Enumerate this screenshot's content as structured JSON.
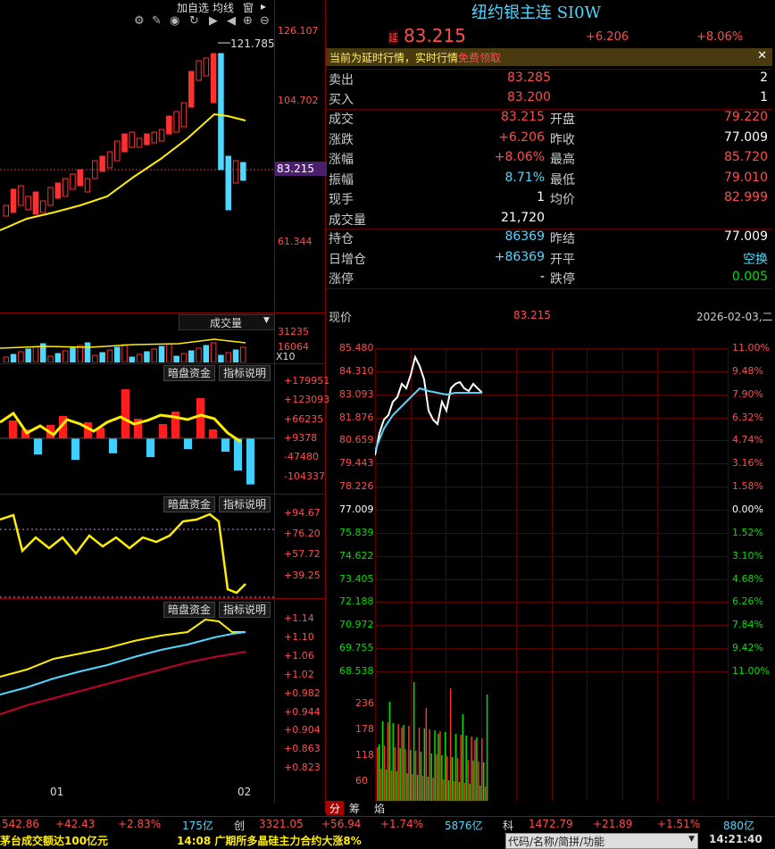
{
  "toolbar": {
    "add_watch": "加自选",
    "ma": "均线",
    "window": "窗",
    "arrow_icon": "arrow-icon"
  },
  "kline": {
    "ticks": [
      "126.107",
      "104.702",
      "83.215",
      "61.344"
    ],
    "max_label": "121.785",
    "current_label": "83.215",
    "x_labels": [
      "01",
      "02"
    ]
  },
  "volume_panel": {
    "selector": "成交量",
    "ticks": [
      "31235",
      "16064",
      "X10"
    ]
  },
  "indicator1": {
    "btn_dark": "暗盘资金",
    "btn_help": "指标说明",
    "ticks": [
      "+179951",
      "+123093",
      "+66235",
      "+9378",
      "-47480",
      "-104337"
    ]
  },
  "indicator2": {
    "btn_dark": "暗盘资金",
    "btn_help": "指标说明",
    "ticks": [
      "+94.67",
      "+76.20",
      "+57.72",
      "+39.25"
    ]
  },
  "indicator3": {
    "btn_dark": "暗盘资金",
    "btn_help": "指标说明",
    "ticks": [
      "+1.14",
      "+1.10",
      "+1.06",
      "+1.02",
      "+0.982",
      "+0.944",
      "+0.904",
      "+0.863",
      "+0.823"
    ]
  },
  "quote": {
    "title": "纽约银主连 SI0W",
    "delay_tag": "延",
    "price": "83.215",
    "change": "+6.206",
    "change_pct": "+8.06%",
    "notice": "当前为延时行情，实时行情",
    "notice_link": "免费领取",
    "sell_label": "卖出",
    "sell_price": "83.285",
    "sell_qty": "2",
    "buy_label": "买入",
    "buy_price": "83.200",
    "buy_qty": "1",
    "rows": [
      {
        "l": "成交",
        "v1": "83.215",
        "l2": "开盘",
        "v2": "79.220"
      },
      {
        "l": "涨跌",
        "v1": "+6.206",
        "l2": "昨收",
        "v2": "77.009"
      },
      {
        "l": "涨幅",
        "v1": "+8.06%",
        "l2": "最高",
        "v2": "85.720"
      },
      {
        "l": "振幅",
        "v1": "8.71%",
        "l2": "最低",
        "v2": "79.010"
      },
      {
        "l": "现手",
        "v1": "1",
        "l2": "均价",
        "v2": "82.999"
      },
      {
        "l": "成交量",
        "v1": "21,720",
        "l2": "",
        "v2": ""
      }
    ],
    "rows2": [
      {
        "l": "持仓",
        "v1": "86369",
        "l2": "昨结",
        "v2": "77.009"
      },
      {
        "l": "日增仓",
        "v1": "+86369",
        "l2": "开平",
        "v2": "空换"
      },
      {
        "l": "涨停",
        "v1": "-",
        "l2": "跌停",
        "v2": "0.005"
      }
    ]
  },
  "intraday": {
    "label_price": "现价",
    "price": "83.215",
    "date": "2026-02-03,二",
    "left_ticks": [
      "85.480",
      "84.310",
      "83.093",
      "81.876",
      "80.659",
      "79.443",
      "78.226",
      "77.009",
      "75.839",
      "74.622",
      "73.405",
      "72.188",
      "70.972",
      "69.755",
      "68.538"
    ],
    "right_ticks": [
      "11.00%",
      "9.48%",
      "7.90%",
      "6.32%",
      "4.74%",
      "3.16%",
      "1.58%",
      "0.00%",
      "1.52%",
      "3.10%",
      "4.68%",
      "6.26%",
      "7.84%",
      "9.42%",
      "11.00%"
    ],
    "vol_ticks": [
      "236",
      "178",
      "118",
      "60"
    ],
    "tabs": [
      "分",
      "筹",
      "焰"
    ]
  },
  "bottom": {
    "idx1": [
      "542.86",
      "+42.43",
      "+2.83%",
      "175亿"
    ],
    "idx2_label": "创",
    "idx2": [
      "3321.05",
      "+56.94",
      "+1.74%",
      "5876亿"
    ],
    "idx3_label": "科",
    "idx3": [
      "1472.79",
      "+21.89",
      "+1.51%",
      "880亿"
    ],
    "news1": "茅台成交额达100亿元",
    "news2": "14:08 广期所多晶硅主力合约大涨8%",
    "search_placeholder": "代码/名称/简拼/功能",
    "time": "14:21:40"
  }
}
